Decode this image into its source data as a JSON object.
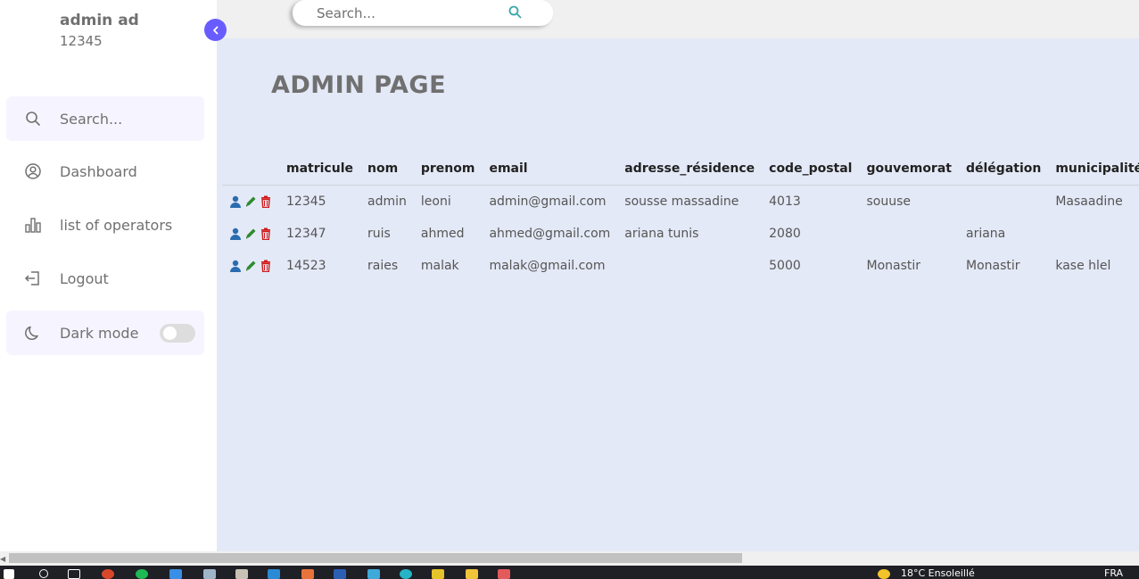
{
  "profile": {
    "name": "admin ad",
    "id": "12345"
  },
  "sidebar": {
    "search_placeholder": "Search...",
    "items": [
      {
        "label": "Dashboard",
        "icon": "dashboard-icon"
      },
      {
        "label": "list of operators",
        "icon": "bar-chart-icon"
      },
      {
        "label": "Logout",
        "icon": "logout-icon"
      }
    ],
    "dark_mode": {
      "label": "Dark mode",
      "enabled": false
    }
  },
  "topbar": {
    "search_placeholder": "Search..."
  },
  "page": {
    "title": "ADMIN PAGE"
  },
  "table": {
    "columns": [
      "matricule",
      "nom",
      "prenom",
      "email",
      "adresse_résidence",
      "code_postal",
      "gouvemorat",
      "délégation",
      "municipalité"
    ],
    "rows": [
      [
        "12345",
        "admin",
        "leoni",
        "admin@gmail.com",
        "sousse massadine",
        "4013",
        "souuse",
        "",
        "Masaadine"
      ],
      [
        "12347",
        "ruis",
        "ahmed",
        "ahmed@gmail.com",
        "ariana tunis",
        "2080",
        "",
        "ariana",
        ""
      ],
      [
        "14523",
        "raies",
        "malak",
        "malak@gmail.com",
        "",
        "5000",
        "Monastir",
        "Monastir",
        "kase hlel"
      ]
    ]
  },
  "taskbar": {
    "tray_text": "18°C  Ensoleillé",
    "lang": "FRA"
  },
  "colors": {
    "accent": "#695cfe",
    "main_bg": "#e4e9f7",
    "view_icon": "#2b6cb0",
    "edit_icon": "#2e8b2e",
    "delete_icon": "#d11a1a"
  }
}
